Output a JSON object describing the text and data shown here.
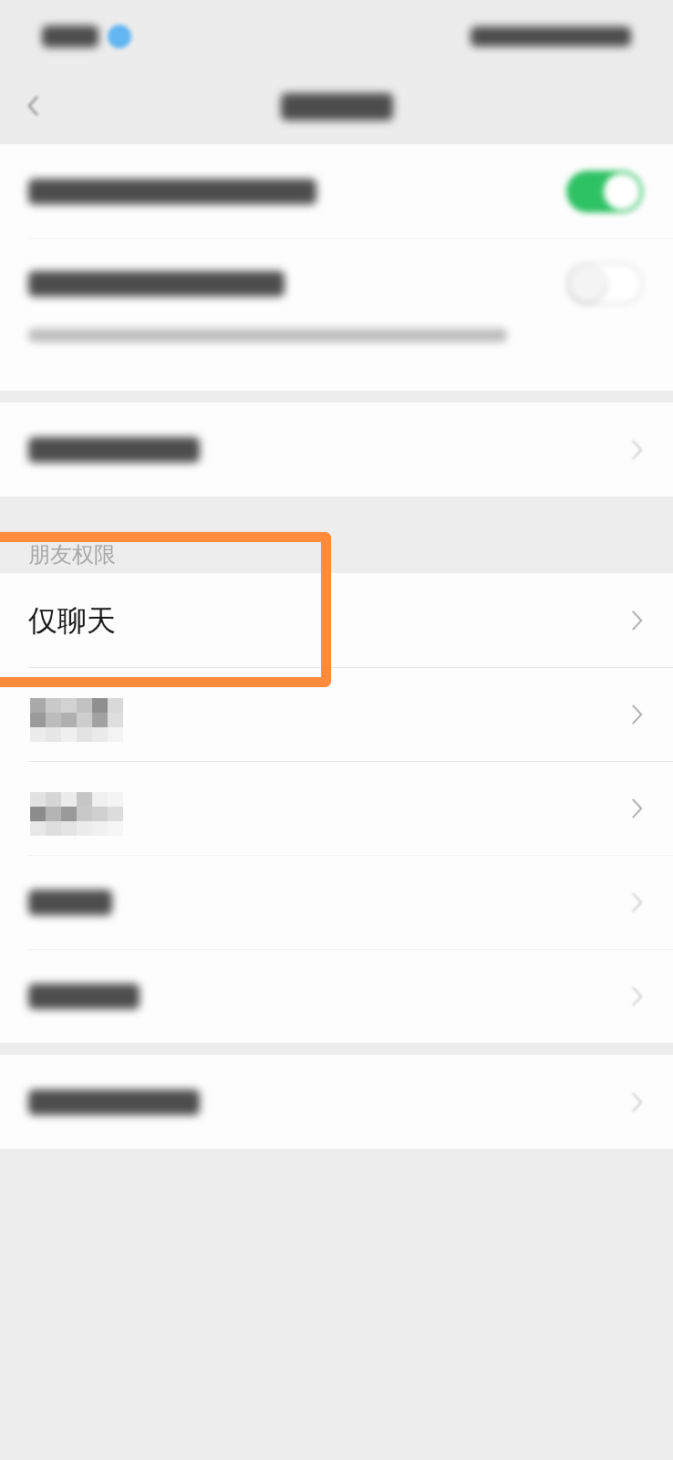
{
  "status_bar": {
    "blurred": true
  },
  "nav_bar": {
    "back": true,
    "title_blurred": true
  },
  "groups": [
    {
      "items": [
        {
          "kind": "toggle",
          "label_blurred": true,
          "on": true,
          "note_blurred": false
        },
        {
          "kind": "toggle",
          "label_blurred": true,
          "on": false,
          "note_blurred": true
        }
      ]
    },
    {
      "items": [
        {
          "kind": "link",
          "label_blurred": true
        }
      ]
    },
    {
      "header": "朋友权限",
      "items": [
        {
          "kind": "link",
          "label": "仅聊天",
          "highlighted": true
        },
        {
          "kind": "link",
          "label_pixelated": true,
          "highlighted": false
        },
        {
          "kind": "link",
          "label_pixelated": true,
          "highlighted": false
        },
        {
          "kind": "link",
          "label_blurred": true,
          "highlighted": false
        },
        {
          "kind": "link",
          "label_blurred": true,
          "highlighted": false
        }
      ]
    },
    {
      "items": [
        {
          "kind": "link",
          "label_blurred": true
        }
      ]
    }
  ]
}
